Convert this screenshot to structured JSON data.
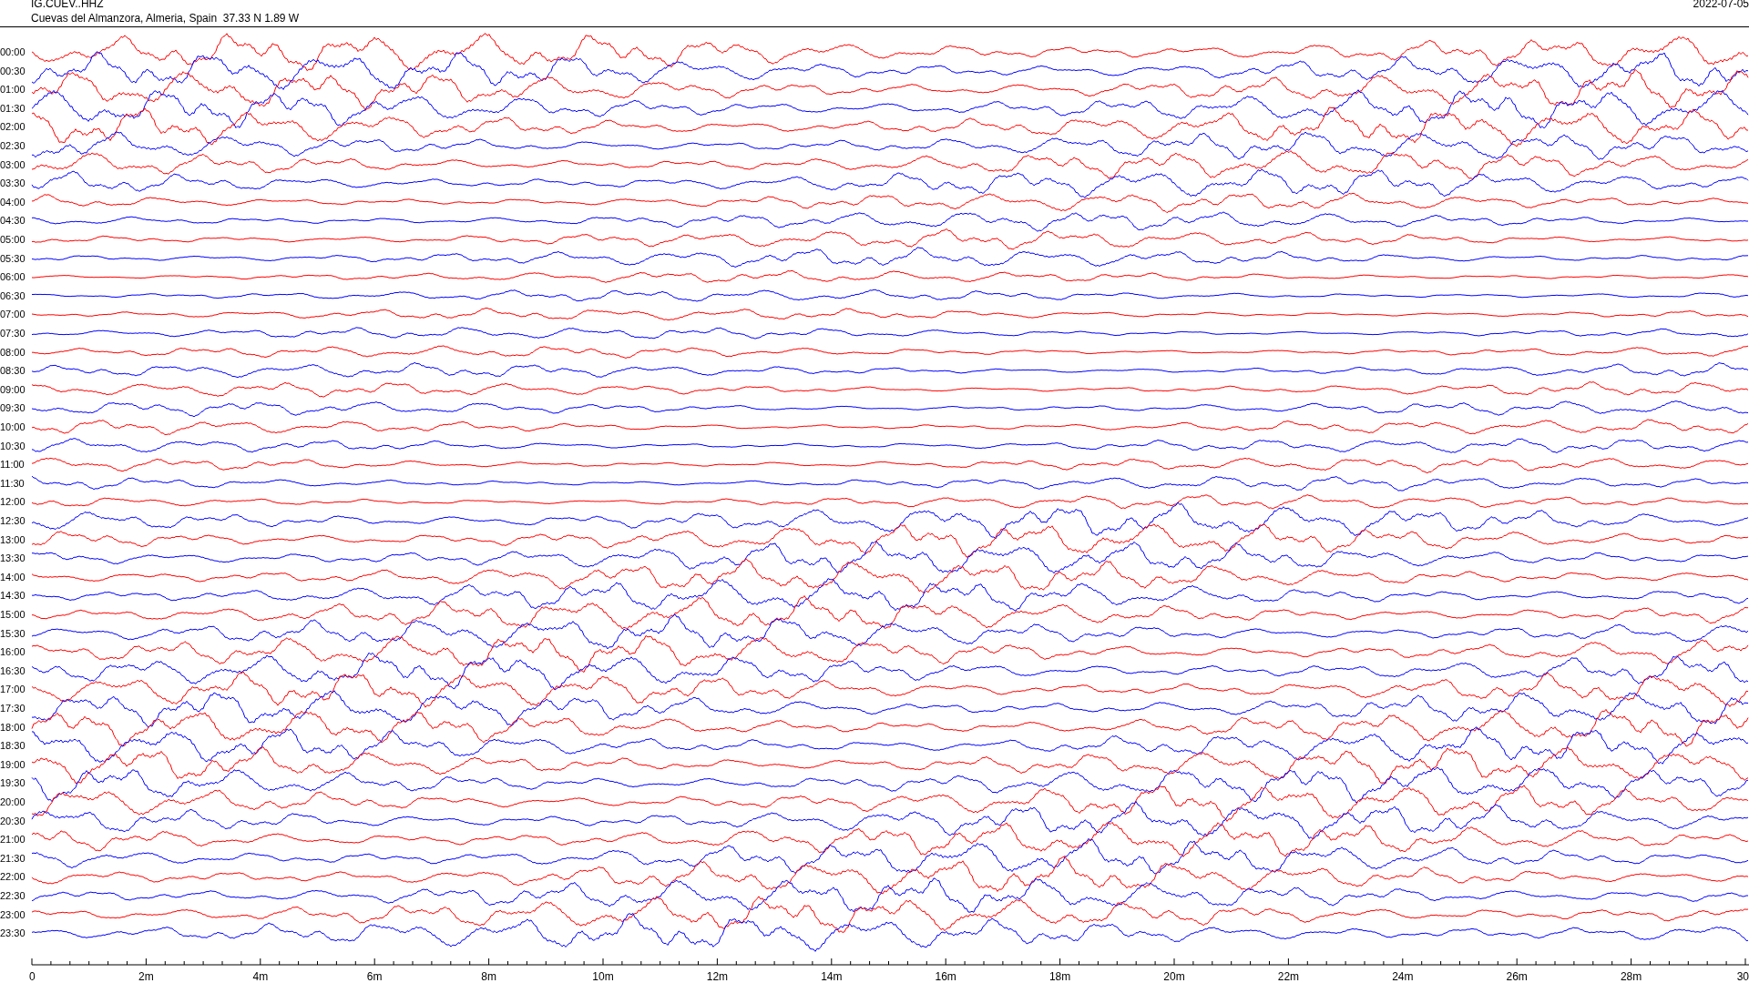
{
  "header": {
    "station": "IG.CUEV..HHZ",
    "location": "Cuevas del Almanzora, Almeria, Spain  37.33 N 1.89 W",
    "date": "2022-07-05"
  },
  "traces": [
    {
      "label": "00:00",
      "color": "#ff0000"
    },
    {
      "label": "00:30",
      "color": "#0000ff"
    },
    {
      "label": "01:00",
      "color": "#ff0000"
    },
    {
      "label": "01:30",
      "color": "#0000ff"
    },
    {
      "label": "02:00",
      "color": "#ff0000"
    },
    {
      "label": "02:30",
      "color": "#0000ff"
    },
    {
      "label": "03:00",
      "color": "#ff0000"
    },
    {
      "label": "03:30",
      "color": "#0000ff"
    },
    {
      "label": "04:00",
      "color": "#ff0000"
    },
    {
      "label": "04:30",
      "color": "#0000ff"
    },
    {
      "label": "05:00",
      "color": "#ff0000"
    },
    {
      "label": "05:30",
      "color": "#0000ff"
    },
    {
      "label": "06:00",
      "color": "#ff0000"
    },
    {
      "label": "06:30",
      "color": "#0000ff"
    },
    {
      "label": "07:00",
      "color": "#ff0000"
    },
    {
      "label": "07:30",
      "color": "#0000ff"
    },
    {
      "label": "08:00",
      "color": "#ff0000"
    },
    {
      "label": "08:30",
      "color": "#0000ff"
    },
    {
      "label": "09:00",
      "color": "#ff0000"
    },
    {
      "label": "09:30",
      "color": "#0000ff"
    },
    {
      "label": "10:00",
      "color": "#ff0000"
    },
    {
      "label": "10:30",
      "color": "#0000ff"
    },
    {
      "label": "11:00",
      "color": "#ff0000"
    },
    {
      "label": "11:30",
      "color": "#0000ff"
    },
    {
      "label": "12:00",
      "color": "#ff0000"
    },
    {
      "label": "12:30",
      "color": "#0000ff"
    },
    {
      "label": "13:00",
      "color": "#ff0000"
    },
    {
      "label": "13:30",
      "color": "#0000ff"
    },
    {
      "label": "14:00",
      "color": "#ff0000"
    },
    {
      "label": "14:30",
      "color": "#0000ff"
    },
    {
      "label": "15:00",
      "color": "#ff0000"
    },
    {
      "label": "15:30",
      "color": "#0000ff"
    },
    {
      "label": "16:00",
      "color": "#ff0000"
    },
    {
      "label": "16:30",
      "color": "#0000ff"
    },
    {
      "label": "17:00",
      "color": "#ff0000"
    },
    {
      "label": "17:30",
      "color": "#0000ff"
    },
    {
      "label": "18:00",
      "color": "#ff0000"
    },
    {
      "label": "18:30",
      "color": "#0000ff"
    },
    {
      "label": "19:00",
      "color": "#ff0000"
    },
    {
      "label": "19:30",
      "color": "#0000ff"
    },
    {
      "label": "20:00",
      "color": "#ff0000"
    },
    {
      "label": "20:30",
      "color": "#0000ff"
    },
    {
      "label": "21:00",
      "color": "#ff0000"
    },
    {
      "label": "21:30",
      "color": "#0000ff"
    },
    {
      "label": "22:00",
      "color": "#ff0000"
    },
    {
      "label": "22:30",
      "color": "#0000ff"
    },
    {
      "label": "23:00",
      "color": "#ff0000"
    },
    {
      "label": "23:30",
      "color": "#0000ff"
    }
  ],
  "x_axis": {
    "ticks": [
      "0",
      "2m",
      "4m",
      "6m",
      "8m",
      "10m",
      "12m",
      "14m",
      "16m",
      "18m",
      "20m",
      "22m",
      "24m",
      "26m",
      "28m",
      "30"
    ]
  }
}
